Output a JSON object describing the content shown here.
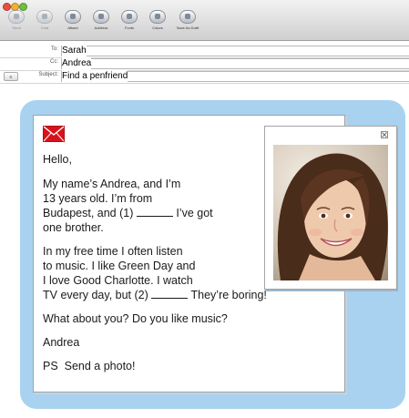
{
  "toolbar": {
    "buttons": [
      {
        "label": "Send",
        "icon": "send-icon",
        "enabled": false
      },
      {
        "label": "Chat",
        "icon": "chat-icon",
        "enabled": false
      },
      {
        "label": "Attach",
        "icon": "paperclip-icon",
        "enabled": true
      },
      {
        "label": "Address",
        "icon": "address-book-icon",
        "enabled": true
      },
      {
        "label": "Fonts",
        "icon": "fonts-icon",
        "enabled": true
      },
      {
        "label": "Colors",
        "icon": "colors-icon",
        "enabled": true
      },
      {
        "label": "Save As Draft",
        "icon": "draft-icon",
        "enabled": true
      }
    ]
  },
  "fields": {
    "to_label": "To:",
    "to_value": "Sarah",
    "cc_label": "Cc:",
    "cc_value": "Andrea",
    "subject_label": "Subject:",
    "subject_value": "Find a penfriend",
    "account_select": "≡"
  },
  "message": {
    "greeting": "Hello,",
    "p1_line1": "My name’s Andrea, and I’m",
    "p1_line2": "13 years old. I’m from",
    "p1_line3_a": "Budapest, and (1) ",
    "p1_line3_b": " I’ve got",
    "p1_line4": "one brother.",
    "p2_line1": "In my free time I often listen",
    "p2_line2": "to music. I like Green Day and",
    "p2_line3": "I love Good Charlotte. I watch",
    "p2_line4_a": "TV every day, but (2) ",
    "p2_line4_b": " They’re boring!",
    "question": "What about you? Do you like music?",
    "signature": "Andrea",
    "ps": "PS  Send a photo!"
  },
  "colors": {
    "panel": "#a8d2ef",
    "envelope": "#d8121b"
  },
  "icons": {
    "envelope": "envelope-icon",
    "close": "close-icon",
    "photo": "girl-portrait-photo"
  }
}
